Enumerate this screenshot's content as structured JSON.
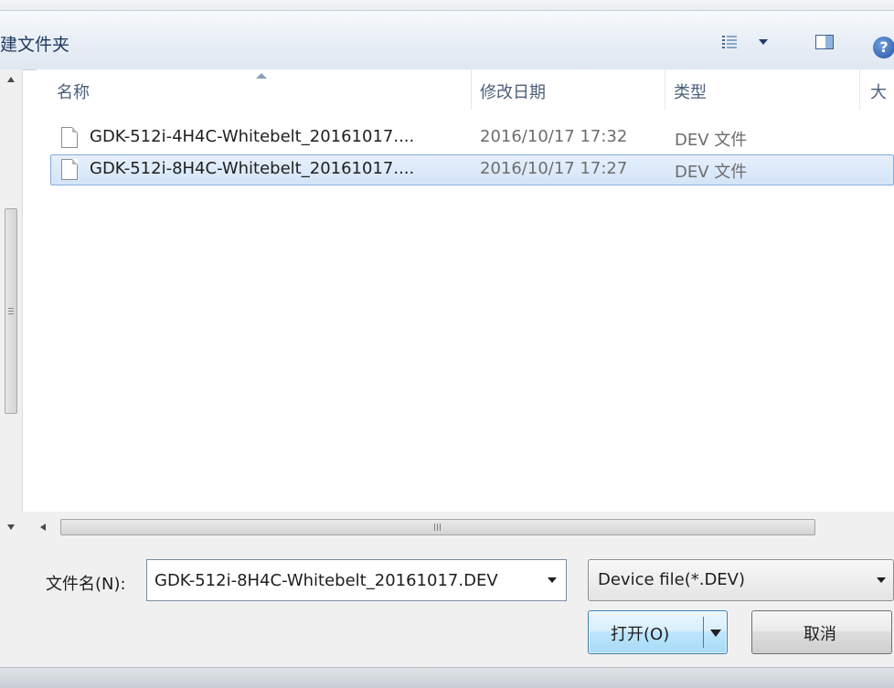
{
  "toolbar": {
    "title": "建文件夹",
    "views_icon": "details-view-icon",
    "preview_icon": "preview-pane-icon",
    "help_icon": "help-icon",
    "help_glyph": "?"
  },
  "columns": {
    "name": "名称",
    "date": "修改日期",
    "type": "类型",
    "size": "大"
  },
  "files": [
    {
      "name": "GDK-512i-4H4C-Whitebelt_20161017....",
      "date": "2016/10/17 17:32",
      "type": "DEV 文件",
      "selected": false
    },
    {
      "name": "GDK-512i-8H4C-Whitebelt_20161017....",
      "date": "2016/10/17 17:27",
      "type": "DEV 文件",
      "selected": true
    }
  ],
  "hscroll": {
    "grip": "III"
  },
  "bottom": {
    "filename_label": "文件名(N):",
    "filename_value": "GDK-512i-8H4C-Whitebelt_20161017.DEV",
    "filetype_value": "Device file(*.DEV)",
    "open_label": "打开(O)",
    "cancel_label": "取消"
  },
  "colors": {
    "selection": "#cce0f7",
    "header_text": "#4c607a",
    "secondary_text": "#6d6d6d",
    "toolbar_bg": "#e8eef6"
  }
}
